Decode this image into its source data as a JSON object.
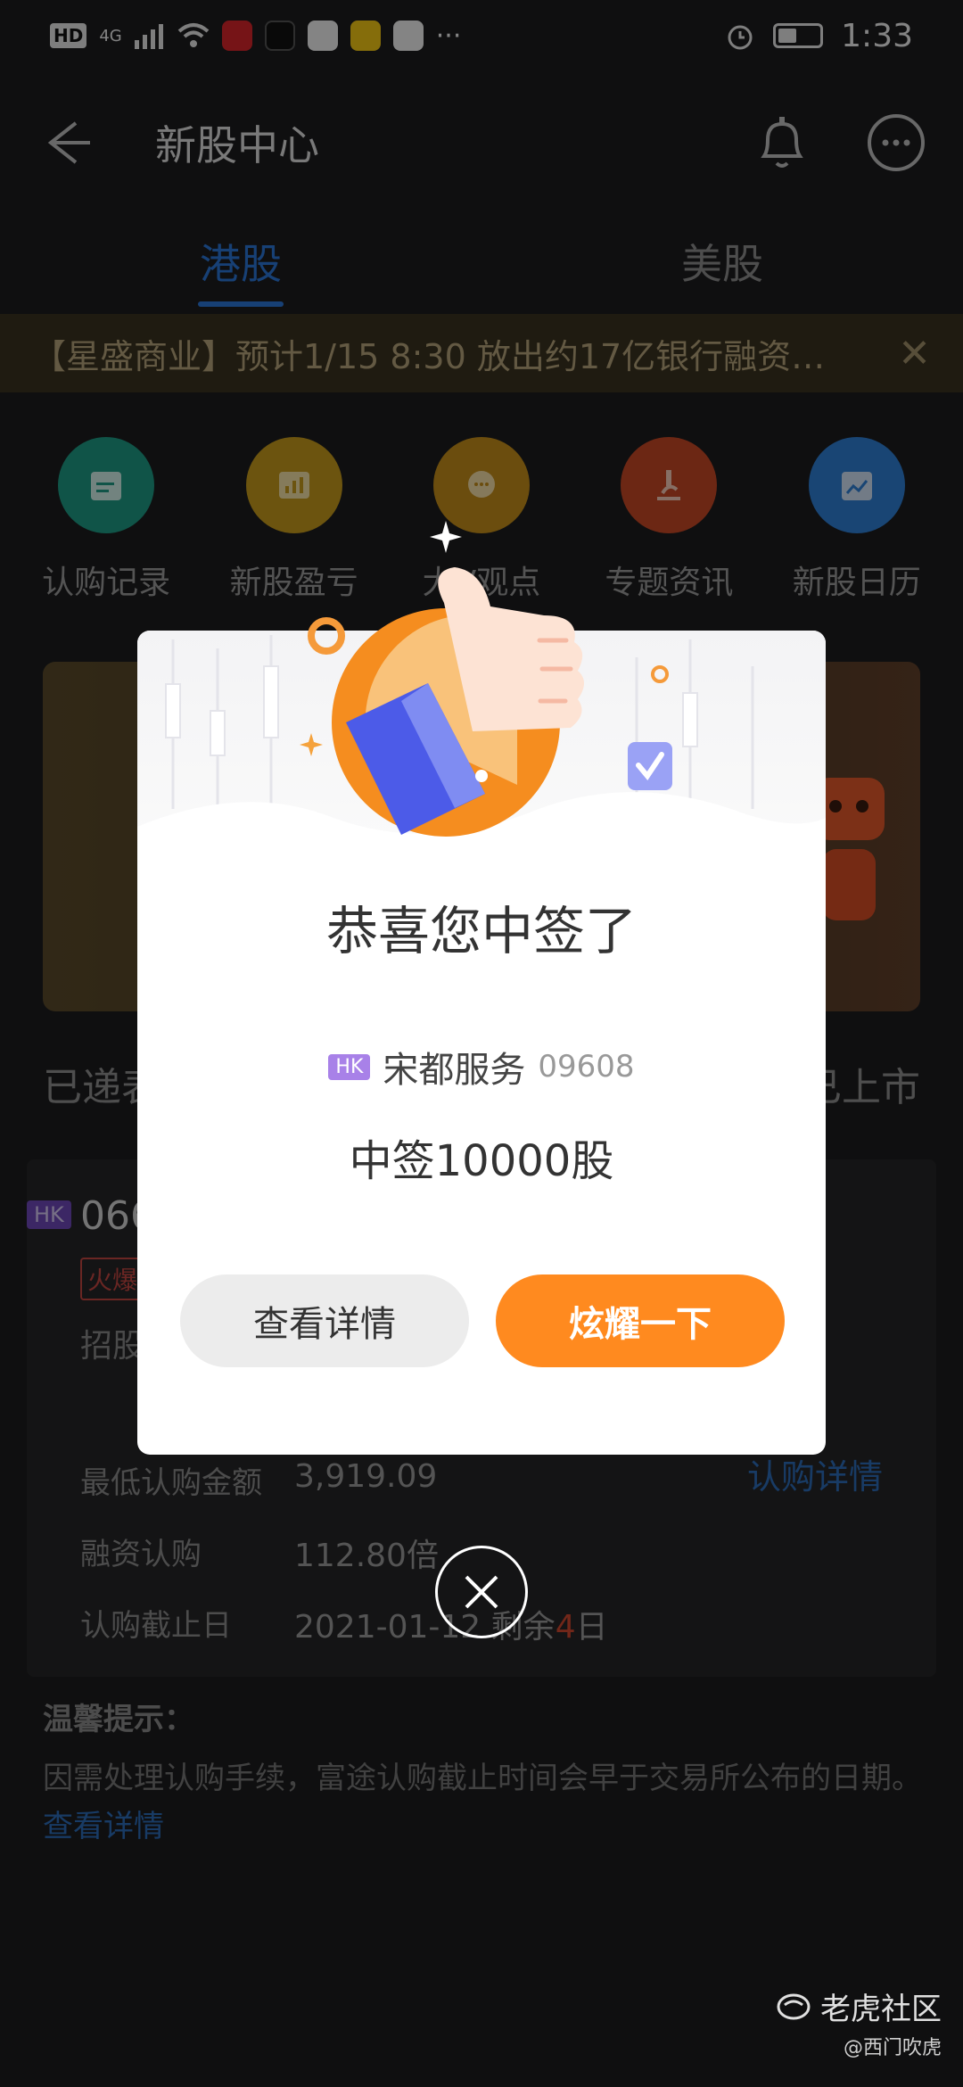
{
  "status_bar": {
    "network": "4G",
    "time": "1:33"
  },
  "header": {
    "title": "新股中心"
  },
  "tabs": [
    {
      "label": "港股"
    },
    {
      "label": "美股"
    }
  ],
  "notice": {
    "text": "【星盛商业】预计1/15 8:30 放出约17亿银行融资…"
  },
  "quick_actions": [
    {
      "label": "认购记录",
      "color": "#1e9a84"
    },
    {
      "label": "新股盈亏",
      "color": "#c59a1d"
    },
    {
      "label": "大V观点",
      "color": "#c38d1a"
    },
    {
      "label": "专题资讯",
      "color": "#c54726"
    },
    {
      "label": "新股日历",
      "color": "#2f7fd3"
    }
  ],
  "section": {
    "left": "已递表",
    "right": "已上市"
  },
  "card": {
    "market": "HK",
    "code": "066",
    "tag": "火爆",
    "subtitle": "招股",
    "rows": [
      {
        "label": "最低认购金额",
        "value": "3,919.09"
      },
      {
        "label": "融资认购",
        "value": "112.80倍"
      },
      {
        "label": "认购截止日",
        "value": "2021-01-12",
        "suffix_a": "剩余",
        "days": "4",
        "suffix_b": "日"
      }
    ],
    "link": "认购详情"
  },
  "tips": {
    "title": "温馨提示：",
    "body": "因需处理认购手续，富途认购截止时间会早于交易所公布的日期。",
    "link": "查看详情"
  },
  "modal": {
    "title": "恭喜您中签了",
    "market": "HK",
    "stock_name": "宋都服务",
    "stock_code": "09608",
    "result": "中签10000股",
    "btn_view": "查看详情",
    "btn_share": "炫耀一下"
  },
  "watermark": {
    "brand": "老虎社区",
    "user": "@西门吹虎"
  }
}
